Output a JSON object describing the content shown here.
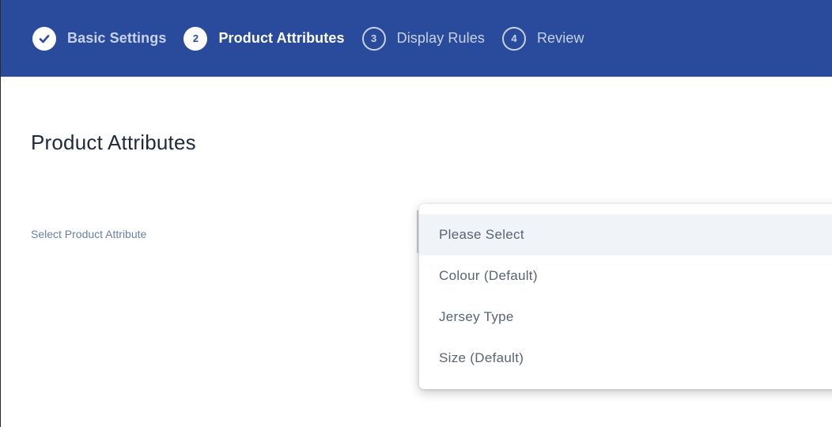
{
  "stepper": {
    "steps": [
      {
        "marker": "✓",
        "label": "Basic Settings",
        "state": "completed"
      },
      {
        "marker": "2",
        "label": "Product Attributes",
        "state": "active"
      },
      {
        "marker": "3",
        "label": "Display Rules",
        "state": "upcoming"
      },
      {
        "marker": "4",
        "label": "Review",
        "state": "upcoming"
      }
    ]
  },
  "main": {
    "title": "Product Attributes",
    "field_label": "Select Product Attribute"
  },
  "dropdown": {
    "selected": "Please Select",
    "options": [
      "Please Select",
      "Colour (Default)",
      "Jersey Type",
      "Size (Default)"
    ]
  },
  "colors": {
    "header_bg": "#2a4b9b",
    "title": "#1f2a3c",
    "label": "#6a7fa8",
    "option_text": "#5a6470",
    "highlight": "#f0f3f8"
  }
}
